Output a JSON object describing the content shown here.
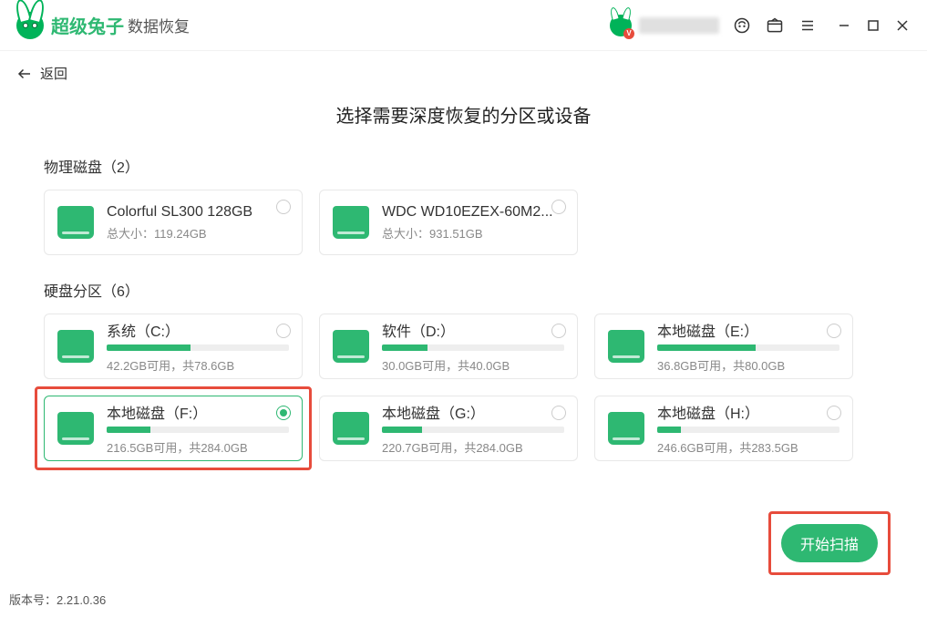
{
  "header": {
    "logo_text_1": "超级兔子",
    "logo_text_2": "数据恢复",
    "vbadge": "V"
  },
  "back_label": "返回",
  "page_title": "选择需要深度恢复的分区或设备",
  "physical": {
    "title": "物理磁盘（2）",
    "disks": [
      {
        "name": "Colorful SL300 128GB",
        "size_label": "总大小：",
        "size": "119.24GB"
      },
      {
        "name": "WDC WD10EZEX-60M2...",
        "size_label": "总大小：",
        "size": "931.51GB"
      }
    ]
  },
  "partitions": {
    "title": "硬盘分区（6）",
    "items": [
      {
        "name": "系统（C:）",
        "usage": "42.2GB可用，共78.6GB",
        "percent": 46
      },
      {
        "name": "软件（D:）",
        "usage": "30.0GB可用，共40.0GB",
        "percent": 25
      },
      {
        "name": "本地磁盘（E:）",
        "usage": "36.8GB可用，共80.0GB",
        "percent": 54
      },
      {
        "name": "本地磁盘（F:）",
        "usage": "216.5GB可用，共284.0GB",
        "percent": 24,
        "selected": true
      },
      {
        "name": "本地磁盘（G:）",
        "usage": "220.7GB可用，共284.0GB",
        "percent": 22
      },
      {
        "name": "本地磁盘（H:）",
        "usage": "246.6GB可用，共283.5GB",
        "percent": 13
      }
    ]
  },
  "scan_button": "开始扫描",
  "version_label": "版本号：",
  "version": "2.21.0.36",
  "colors": {
    "accent": "#2eb872",
    "danger": "#e74c3c"
  }
}
